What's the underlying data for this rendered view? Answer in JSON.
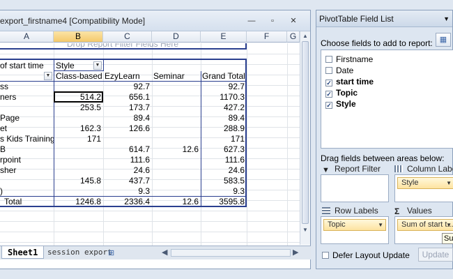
{
  "window": {
    "title": "export_firstname4 [Compatibility Mode]",
    "minimize_glyph": "—",
    "restore_glyph": "▫",
    "close_glyph": "✕"
  },
  "columns": [
    "A",
    "B",
    "C",
    "D",
    "E",
    "F",
    "G"
  ],
  "drop_zone": "Drop Report Filter Fields Here",
  "pivot": {
    "row_field": "of start time",
    "col_field": "Style",
    "headers": [
      "Class-based",
      "EzyLearn",
      "Seminar",
      "Grand Total"
    ],
    "rows": [
      {
        "label": "ss",
        "b": "",
        "c": "92.7",
        "d": "",
        "e": "92.7"
      },
      {
        "label": "ners",
        "b": "514.2",
        "c": "656.1",
        "d": "",
        "e": "1170.3"
      },
      {
        "label": "",
        "b": "253.5",
        "c": "173.7",
        "d": "",
        "e": "427.2"
      },
      {
        "label": "Page",
        "b": "",
        "c": "89.4",
        "d": "",
        "e": "89.4"
      },
      {
        "label": "et",
        "b": "162.3",
        "c": "126.6",
        "d": "",
        "e": "288.9"
      },
      {
        "label": "s Kids Training",
        "b": "171",
        "c": "",
        "d": "",
        "e": "171"
      },
      {
        "label": "B",
        "b": "",
        "c": "614.7",
        "d": "12.6",
        "e": "627.3"
      },
      {
        "label": "rpoint",
        "b": "",
        "c": "111.6",
        "d": "",
        "e": "111.6"
      },
      {
        "label": "sher",
        "b": "",
        "c": "24.6",
        "d": "",
        "e": "24.6"
      },
      {
        "label": "",
        "b": "145.8",
        "c": "437.7",
        "d": "",
        "e": "583.5"
      },
      {
        "label": ")",
        "b": "",
        "c": "9.3",
        "d": "",
        "e": "9.3"
      }
    ],
    "total": {
      "label": "Total",
      "b": "1246.8",
      "c": "2336.4",
      "d": "12.6",
      "e": "3595.8"
    }
  },
  "sheet_tabs": {
    "active": "Sheet1",
    "other": "session export"
  },
  "panel": {
    "title": "PivotTable Field List",
    "choose_label": "Choose fields to add to report:",
    "fields": [
      {
        "name": "Firstname",
        "checked": false,
        "bold": false
      },
      {
        "name": "Date",
        "checked": false,
        "bold": false
      },
      {
        "name": "start time",
        "checked": true,
        "bold": true
      },
      {
        "name": "Topic",
        "checked": true,
        "bold": true
      },
      {
        "name": "Style",
        "checked": true,
        "bold": true
      }
    ],
    "drag_label": "Drag fields between areas below:",
    "report_filter": "Report Filter",
    "column_labels": "Column Labels",
    "column_chip": "Style",
    "row_labels": "Row Labels",
    "row_chip": "Topic",
    "values": "Values",
    "values_chip": "Sum of start t...",
    "tooltip": "Sun",
    "defer_label": "Defer Layout Update",
    "update_label": "Update"
  }
}
